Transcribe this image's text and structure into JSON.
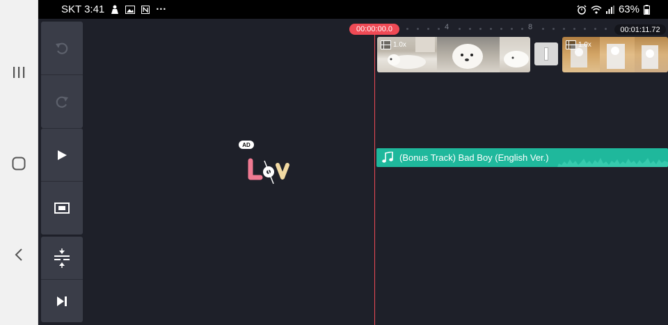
{
  "status_bar": {
    "carrier_time": "SKT 3:41",
    "more": "···",
    "battery": "63%"
  },
  "system_nav": {
    "recents_icon": "recents-icon",
    "home_icon": "home-icon",
    "back_icon": "back-icon"
  },
  "tools": [
    {
      "name": "undo",
      "icon": "undo-icon"
    },
    {
      "name": "redo",
      "icon": "redo-icon"
    },
    {
      "name": "play",
      "icon": "play-icon"
    },
    {
      "name": "screen-capture",
      "icon": "screen-capture-icon"
    },
    {
      "name": "expand-timeline",
      "icon": "expand-timeline-icon"
    },
    {
      "name": "skip-to-end",
      "icon": "skip-to-end-icon"
    }
  ],
  "preview": {
    "ad_badge": "AD",
    "logo_text": "LoV"
  },
  "timeline": {
    "playhead_time": "00:00:00.0",
    "ruler_marks": [
      "4",
      "8"
    ],
    "total_time": "00:01:11.72",
    "clips": [
      {
        "speed": "1.0x"
      },
      {
        "speed": "1.0x"
      }
    ],
    "audio_track": {
      "title": "(Bonus Track) Bad Boy (English Ver.)"
    }
  },
  "colors": {
    "accent_red": "#ef4a55",
    "audio_green": "#1fb89c",
    "panel": "#3a3d48",
    "background": "#1e2029"
  }
}
